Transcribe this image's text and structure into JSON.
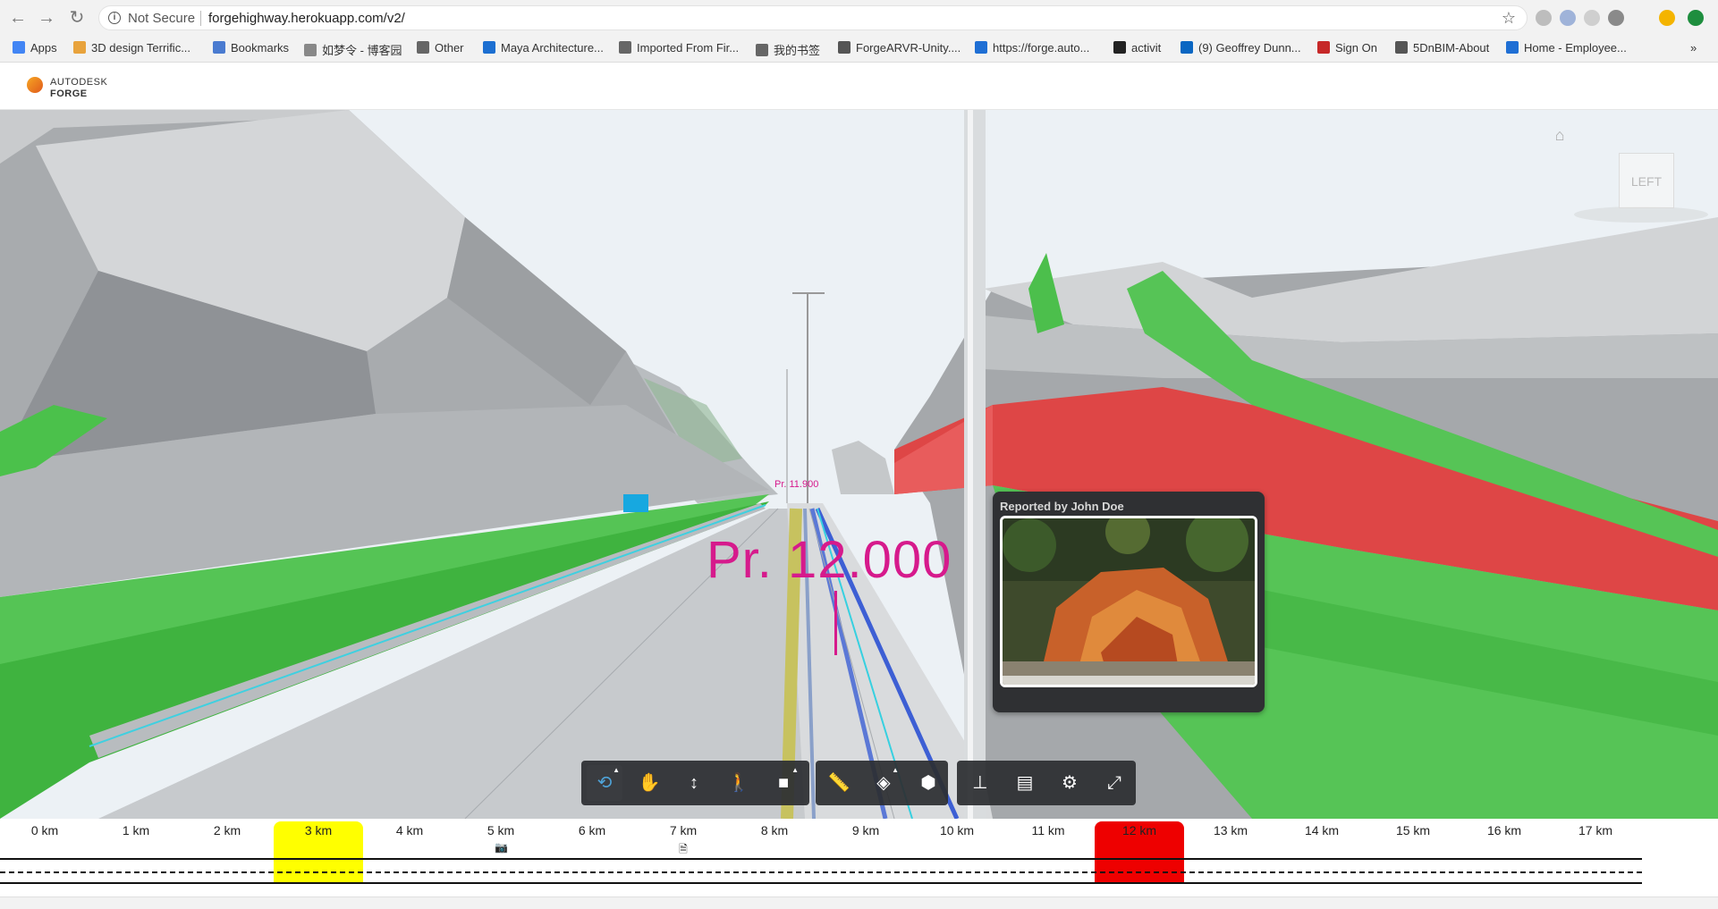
{
  "browser": {
    "security_label": "Not Secure",
    "url": "forgehighway.herokuapp.com/v2/",
    "bookmarks": [
      {
        "label": "Apps",
        "color": "#4285f4"
      },
      {
        "label": "3D design Terrific...",
        "color": "#e8a33c"
      },
      {
        "label": "Bookmarks",
        "color": "#4a7bd0"
      },
      {
        "label": "如梦令 - 博客园",
        "color": "#888888"
      },
      {
        "label": "Other",
        "color": "#666666"
      },
      {
        "label": "Maya Architecture...",
        "color": "#1c6fd1"
      },
      {
        "label": "Imported From Fir...",
        "color": "#666666"
      },
      {
        "label": "我的书签",
        "color": "#666666"
      },
      {
        "label": "ForgeARVR-Unity....",
        "color": "#555555"
      },
      {
        "label": "https://forge.auto...",
        "color": "#1f6fd4"
      },
      {
        "label": "activit",
        "color": "#222222"
      },
      {
        "label": "(9) Geoffrey Dunn...",
        "color": "#0a66c2"
      },
      {
        "label": "Sign On",
        "color": "#c62828"
      },
      {
        "label": "5DnBIM-About",
        "color": "#555555"
      },
      {
        "label": "Home - Employee...",
        "color": "#1f6fd4"
      }
    ],
    "overflow": "»"
  },
  "app": {
    "brand_line1": "AUTODESK",
    "brand_line2": "FORGE"
  },
  "viewer": {
    "station_far": "Pr. 11.900",
    "station_label": "Pr. 12.000",
    "viewcube_face": "LEFT",
    "popup": {
      "title": "Reported by John Doe"
    },
    "toolbar": [
      {
        "name": "orbit-tool",
        "icon": "orbit-icon",
        "glyph": "⟲",
        "active": true,
        "flyout": true
      },
      {
        "name": "pan-tool",
        "icon": "hand-icon",
        "glyph": "✋",
        "active": false,
        "flyout": false
      },
      {
        "name": "zoom-tool",
        "icon": "vertical-arrows-icon",
        "glyph": "↕",
        "active": false,
        "flyout": false
      },
      {
        "name": "first-person-tool",
        "icon": "person-icon",
        "glyph": "🚶",
        "active": false,
        "flyout": false
      },
      {
        "name": "camera-tool",
        "icon": "camera-icon",
        "glyph": "■",
        "active": false,
        "flyout": true
      },
      {
        "name": "measure-tool",
        "icon": "ruler-icon",
        "glyph": "📏",
        "active": false,
        "flyout": false
      },
      {
        "name": "section-tool",
        "icon": "section-box-icon",
        "glyph": "◈",
        "active": false,
        "flyout": true
      },
      {
        "name": "explode-tool",
        "icon": "cube-icon",
        "glyph": "⬢",
        "active": false,
        "flyout": false
      },
      {
        "name": "model-browser-tool",
        "icon": "tree-icon",
        "glyph": "⊥",
        "active": false,
        "flyout": false
      },
      {
        "name": "properties-tool",
        "icon": "properties-icon",
        "glyph": "▤",
        "active": false,
        "flyout": false
      },
      {
        "name": "settings-tool",
        "icon": "gear-icon",
        "glyph": "⚙",
        "active": false,
        "flyout": false
      },
      {
        "name": "fullscreen-tool",
        "icon": "fullscreen-icon",
        "glyph": "⤢",
        "active": false,
        "flyout": false
      }
    ]
  },
  "timeline": {
    "labels": [
      "0 km",
      "1 km",
      "2 km",
      "3 km",
      "4 km",
      "5 km",
      "6 km",
      "7 km",
      "8 km",
      "9 km",
      "10 km",
      "11 km",
      "12 km",
      "13 km",
      "14 km",
      "15 km",
      "16 km",
      "17 km"
    ],
    "highlights": [
      {
        "km": 3,
        "color": "#ffff00",
        "label": "3 km"
      },
      {
        "km": 12,
        "color": "#ee0000",
        "label": "12 km"
      }
    ],
    "markers": [
      {
        "km": 5,
        "icon": "camera-icon",
        "glyph": "📷"
      },
      {
        "km": 7,
        "icon": "document-icon",
        "glyph": "🗎"
      }
    ]
  }
}
